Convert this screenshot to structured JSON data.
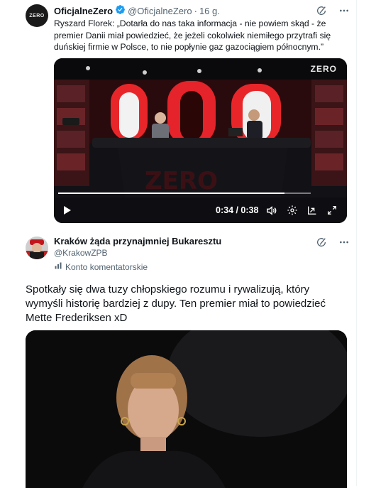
{
  "quoted_tweet": {
    "author_name": "OficjalneZero",
    "handle": "@OficjalneZero",
    "separator": "·",
    "time": "16 g.",
    "avatar_text": "ZERO",
    "text": "Ryszard Florek: „Dotarła do nas taka informacja - nie powiem skąd - że premier Danii miał powiedzieć, że jeżeli cokolwiek niemiłego przytrafi się duńskiej firmie w Polsce, to nie popłynie gaz gazociągiem północnym.”",
    "video": {
      "logo": "ZERO",
      "time_label": "0:34 / 0:38",
      "progress": 0.895
    }
  },
  "reply_tweet": {
    "author_name": "Kraków żąda przynajmniej Bukaresztu",
    "handle": "@KrakowZPB",
    "account_label": "Konto komentatorskie",
    "text": "Spotkały się dwa tuzy chłopskiego rozumu i rywalizują, który wymyśli historię bardziej z dupy. Ten premier miał to powiedzieć Mette Frederiksen xD"
  },
  "icons": {
    "verified": "verified-badge-icon",
    "grok": "grok-icon",
    "more": "more-icon",
    "play": "play-icon",
    "volume": "volume-icon",
    "settings": "settings-gear-icon",
    "pip": "picture-in-picture-icon",
    "fullscreen": "fullscreen-icon",
    "comment_label": "comment-label-icon"
  },
  "colors": {
    "verified_blue": "#1d9bf0",
    "secondary_text": "#536471",
    "primary_text": "#0f1419"
  }
}
